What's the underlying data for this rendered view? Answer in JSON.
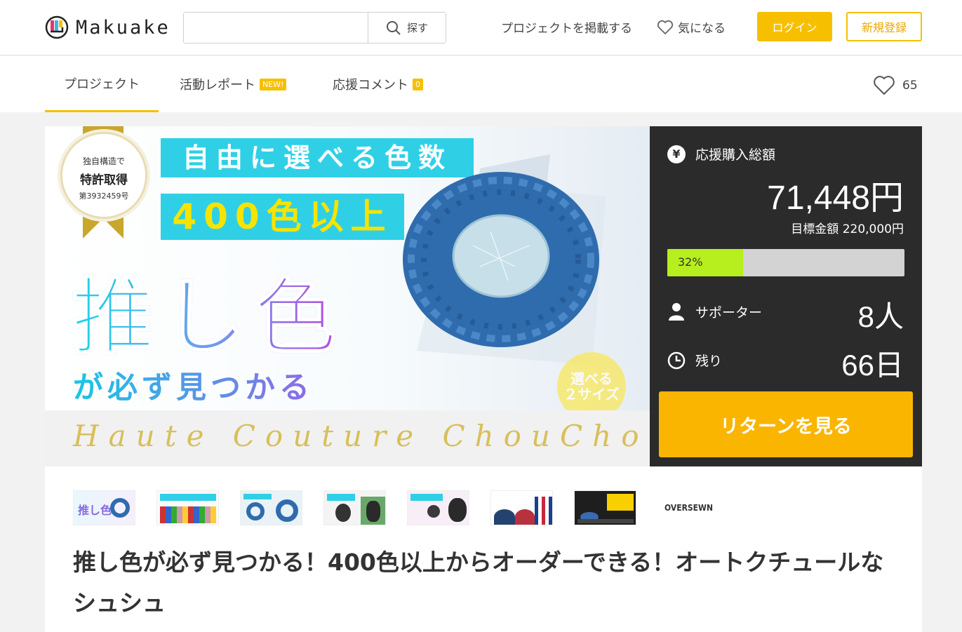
{
  "header": {
    "logo_text": "Makuake",
    "search_placeholder": "",
    "search_button": "探す",
    "post_project": "プロジェクトを掲載する",
    "favorite_link": "気になる",
    "login": "ログイン",
    "signup": "新規登録"
  },
  "tabs": [
    {
      "label": "プロジェクト",
      "badge": ""
    },
    {
      "label": "活動レポート",
      "badge": "NEW!"
    },
    {
      "label": "応援コメント",
      "badge": "0"
    }
  ],
  "favorite_count": "65",
  "visual": {
    "medal_line1": "独自構造で",
    "medal_line2": "特許取得",
    "medal_line3": "第3932459号",
    "band1": "自由に選べる色数",
    "band2": "400色以上",
    "big_text": "推し色",
    "sub_text": "が必ず見つかる",
    "circle_line1": "選べる",
    "circle_line2": "２サイズ",
    "script_text": "Haute Couture ChouChou"
  },
  "panel": {
    "total_label": "応援購入総額",
    "total_amount": "71,448円",
    "goal_label": "目標金額 220,000円",
    "progress_percent": 32,
    "progress_label": "32%",
    "supporters_label": "サポーター",
    "supporters_value": "8人",
    "remaining_label": "残り",
    "remaining_value": "66日",
    "return_button": "リターンを見る"
  },
  "thumbnails": [
    {
      "name": "thumb-1"
    },
    {
      "name": "thumb-2"
    },
    {
      "name": "thumb-3"
    },
    {
      "name": "thumb-4"
    },
    {
      "name": "thumb-5"
    },
    {
      "name": "thumb-6"
    },
    {
      "name": "thumb-7"
    },
    {
      "name": "thumb-8",
      "label": "OVERSEWN"
    }
  ],
  "project_title": "推し色が必ず見つかる！400色以上からオーダーできる！オートクチュールなシュシュ",
  "colors": {
    "brand_yellow": "#f6c000",
    "return_yellow": "#f9b500",
    "progress_green": "#b7ee1d",
    "panel_dark": "#2b2b2b"
  }
}
